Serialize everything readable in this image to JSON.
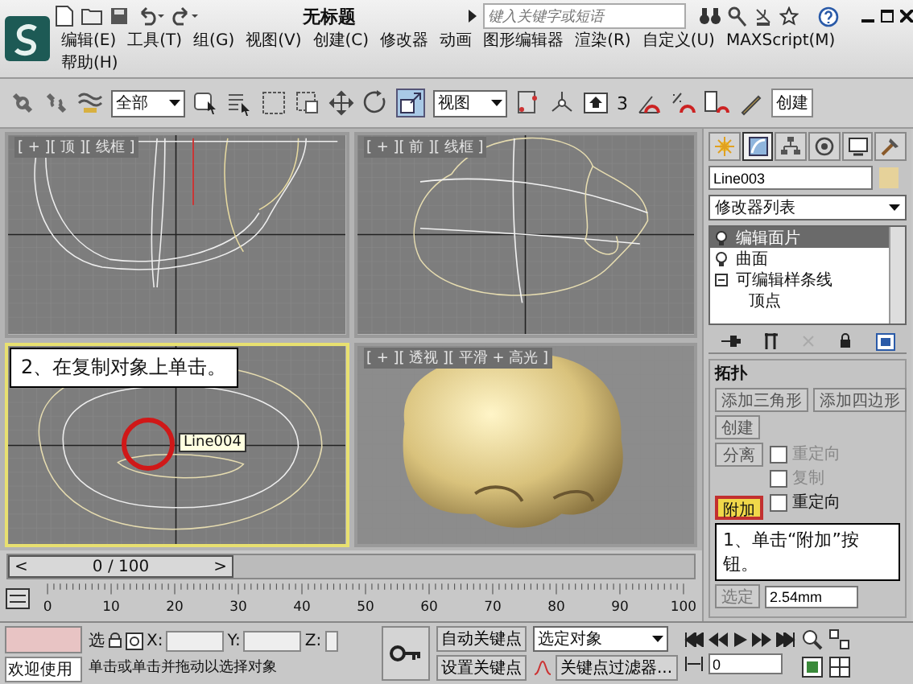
{
  "window": {
    "title": "无标题",
    "search": {
      "placeholder": "键入关键字或短语"
    }
  },
  "menu": [
    {
      "label": "编辑(E)"
    },
    {
      "label": "工具(T)"
    },
    {
      "label": "组(G)"
    },
    {
      "label": "视图(V)"
    },
    {
      "label": "创建(C)"
    },
    {
      "label": "修改器"
    },
    {
      "label": "动画"
    },
    {
      "label": "图形编辑器"
    },
    {
      "label": "渲染(R)"
    },
    {
      "label": "自定义(U)"
    },
    {
      "label": "MAXScript(M)"
    },
    {
      "label": "帮助(H)"
    }
  ],
  "toolbar": {
    "selection_filter": "全部",
    "reference_coord": "视图",
    "snap": "3",
    "named_selection": "创建"
  },
  "viewports": [
    {
      "kind": "top",
      "label": "[ + ][ 顶 ][ 线框 ]",
      "active": false
    },
    {
      "kind": "front",
      "label": "[ + ][ 前 ][ 线框 ]",
      "active": false
    },
    {
      "kind": "left",
      "active": true,
      "callout": "2、在复制对象上单击。",
      "tooltip": "Line004"
    },
    {
      "kind": "perspective",
      "label": "[ + ][ 透视 ][ 平滑 + 高光 ]",
      "active": false
    }
  ],
  "command_panel": {
    "tabs": [
      {
        "kind": "create",
        "selected": false
      },
      {
        "kind": "modify",
        "selected": true
      },
      {
        "kind": "hierarchy",
        "selected": false
      },
      {
        "kind": "motion",
        "selected": false
      },
      {
        "kind": "display",
        "selected": false
      },
      {
        "kind": "utilities",
        "selected": false
      }
    ],
    "object_name": "Line003",
    "modifier_list": "修改器列表",
    "stack": [
      {
        "label": "编辑面片",
        "selected": true
      },
      {
        "label": "曲面",
        "selected": false
      },
      {
        "label": "可编辑样条线",
        "selected": false,
        "children": [
          {
            "label": "顶点",
            "selected": false
          }
        ]
      }
    ],
    "rollout": {
      "title": "拓扑",
      "buttons": [
        {
          "label": "添加三角形",
          "selected": false
        },
        {
          "label": "添加四边形",
          "selected": false
        },
        {
          "label": "创建",
          "selected": false
        }
      ],
      "detach": {
        "label": "分离",
        "selected": false
      },
      "options": [
        {
          "label": "重定向",
          "checked": false,
          "disabled": true
        },
        {
          "label": "复制",
          "checked": false,
          "disabled": true
        }
      ],
      "attach": {
        "label": "附加",
        "selected": true
      },
      "attach_option": {
        "label": "重定向",
        "checked": false,
        "disabled": false
      }
    },
    "callout": "1、单击“附加”按钮。",
    "threshold": {
      "label": "选定",
      "value": "2.54mm"
    }
  },
  "timeline": {
    "prev": "<",
    "position": "0 / 100",
    "next": ">",
    "level": 0,
    "ticks": [
      "0",
      "10",
      "20",
      "30",
      "40",
      "50",
      "60",
      "70",
      "80",
      "90",
      "100"
    ]
  },
  "status": {
    "welcome": "欢迎使用",
    "select_label": "选",
    "x_label": "X:",
    "y_label": "Y:",
    "z_label": "Z:",
    "prompt": "单击或单击并拖动以选择对象",
    "auto_key": "自动关键点",
    "set_key": "设置关键点",
    "key_target": "选定对象",
    "key_filters": "关键点过滤器...",
    "frame": "0"
  }
}
